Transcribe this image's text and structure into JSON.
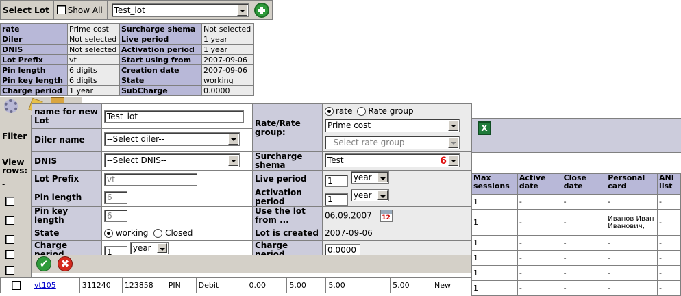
{
  "lotbar": {
    "label": "Select Lot",
    "show_all": "Show All",
    "selected_lot": "Test_lot"
  },
  "info": {
    "rows": [
      {
        "k1": "rate",
        "v1": "Prime cost",
        "k2": "Surcharge shema",
        "v2": "Not selected"
      },
      {
        "k1": "Diler",
        "v1": "Not selected",
        "k2": "Live period",
        "v2": "1 year"
      },
      {
        "k1": "DNIS",
        "v1": "Not selected",
        "k2": "Activation period",
        "v2": "1 year"
      },
      {
        "k1": "Lot Prefix",
        "v1": "vt",
        "k2": "Start using from",
        "v2": "2007-09-06"
      },
      {
        "k1": "Pin length",
        "v1": "6 digits",
        "k2": "Creation date",
        "v2": "2007-09-06"
      },
      {
        "k1": "Pin key length",
        "v1": "6 digits",
        "k2": "State",
        "v2": "working"
      },
      {
        "k1": "Charge period",
        "v1": "1 year",
        "k2": "SubCharge",
        "v2": "0.0000"
      }
    ]
  },
  "left": {
    "filter": "Filter",
    "view_rows_1": "View",
    "view_rows_2": "rows:",
    "dash": "-"
  },
  "grid": {
    "headers": [
      "Max sessions",
      "Active date",
      "Close date",
      "Personal card",
      "ANI list"
    ],
    "rows": [
      [
        "1",
        "-",
        "-",
        "-",
        "-"
      ],
      [
        "1",
        "-",
        "-",
        "Иванов Иван Иванович,",
        "-"
      ],
      [
        "1",
        "-",
        "-",
        "-",
        "-"
      ],
      [
        "1",
        "-",
        "-",
        "-",
        "-"
      ],
      [
        "1",
        "-",
        "-",
        "-",
        "-"
      ],
      [
        "1",
        "-",
        "-",
        "-",
        "-"
      ]
    ]
  },
  "bottom_row": {
    "link": "vt105",
    "c1": "311240",
    "c2": "123858",
    "c3": "PIN",
    "c4": "Debit",
    "c5": "0.00",
    "c6": "5.00",
    "c7": "5.00",
    "c8": "5.00",
    "c9": "New"
  },
  "form": {
    "name_label": "name for new Lot",
    "name_value": "Test_lot",
    "diler_label": "Diler name",
    "diler_value": "--Select diler--",
    "dnis_label": "DNIS",
    "dnis_value": "--Select DNIS--",
    "prefix_label": "Lot Prefix",
    "prefix_value": "vt",
    "pinlen_label": "Pin length",
    "pinlen_value": "6",
    "pinkey_label": "Pin key length",
    "pinkey_value": "6",
    "state_label": "State",
    "state_working": "working",
    "state_closed": "Closed",
    "charge_label": "Charge period",
    "charge_num": "1",
    "charge_unit": "year",
    "rate_label": "Rate/Rate group:",
    "rate_opt": "rate",
    "rategroup_opt": "Rate group",
    "rate_value": "Prime cost",
    "rategroup_value": "--Select rate group--",
    "surcharge_label": "Surcharge shema",
    "surcharge_value": "Test",
    "surcharge_badge": "6",
    "live_label": "Live period",
    "live_num": "1",
    "live_unit": "year",
    "activation_label": "Activation period",
    "activation_num": "1",
    "activation_unit": "year",
    "use_label": "Use the lot from ...",
    "use_value": "06.09.2007",
    "calendar_text": "12",
    "created_label": "Lot is created",
    "created_value": "2007-09-06",
    "charge2_label": "Charge period",
    "charge2_value": "0.0000",
    "ok": "✔",
    "cancel": "✖"
  },
  "icons": {
    "xls": "X"
  }
}
